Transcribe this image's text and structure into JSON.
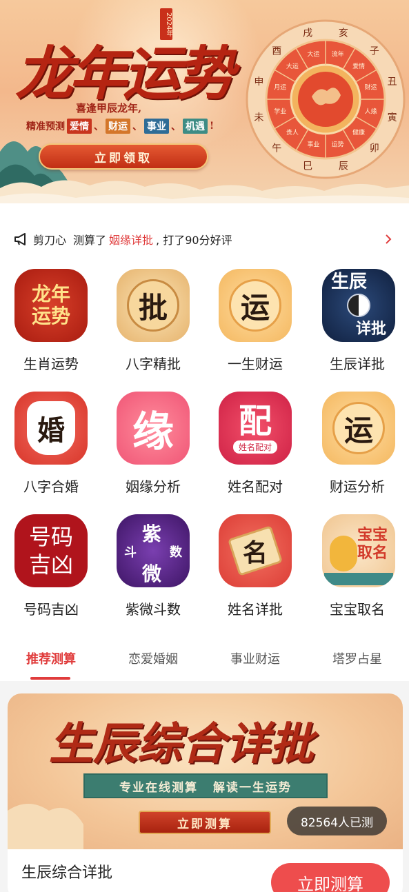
{
  "hero": {
    "title": "龙年运势",
    "year": "2024年",
    "subtitle": "喜逢甲辰龙年,",
    "tags_prefix": "精准预测",
    "tags": [
      "爱情",
      "财运",
      "事业",
      "机遇"
    ],
    "tags_suffix": "!",
    "cta": "立即领取",
    "wheel_outer": [
      "亥",
      "子",
      "丑",
      "寅",
      "卯",
      "辰",
      "巳",
      "午",
      "未",
      "申",
      "酉",
      "戌"
    ],
    "wheel_inner": [
      "流年",
      "爱情",
      "财运",
      "人缘",
      "健康",
      "运势",
      "事业",
      "贵人",
      "学业",
      "月运",
      "大运",
      "大运"
    ]
  },
  "ticker": {
    "user": "剪刀心",
    "action": "测算了",
    "item": "姻缘详批",
    "result": ", 打了90分好评"
  },
  "grid": [
    {
      "label": "生肖运势",
      "icon": "longnian-yunshi-icon",
      "glyph": "龙年运势"
    },
    {
      "label": "八字精批",
      "icon": "pi-icon",
      "glyph": "批"
    },
    {
      "label": "一生财运",
      "icon": "yun-coin-icon",
      "glyph": "运"
    },
    {
      "label": "生辰详批",
      "icon": "shengchen-xiangpi-icon",
      "glyph": "生辰详批"
    },
    {
      "label": "八字合婚",
      "icon": "hun-dress-icon",
      "glyph": "婚"
    },
    {
      "label": "姻缘分析",
      "icon": "yuan-icon",
      "glyph": "缘"
    },
    {
      "label": "姓名配对",
      "icon": "pei-icon",
      "glyph": "配",
      "caption": "姓名配对"
    },
    {
      "label": "财运分析",
      "icon": "yun-coin-icon-2",
      "glyph": "运"
    },
    {
      "label": "号码吉凶",
      "icon": "haoma-jixiong-icon",
      "glyph": "号码吉凶"
    },
    {
      "label": "紫微斗数",
      "icon": "ziwei-doushu-icon",
      "glyph": "紫微斗数"
    },
    {
      "label": "姓名详批",
      "icon": "ming-scroll-icon",
      "glyph": "名"
    },
    {
      "label": "宝宝取名",
      "icon": "baobao-quming-icon",
      "glyph": "宝宝取名"
    }
  ],
  "tabs": [
    "推荐测算",
    "恋爱婚姻",
    "事业财运",
    "塔罗占星"
  ],
  "feature": {
    "banner_title": "生辰综合详批",
    "slogan_left": "专业在线测算",
    "slogan_right": "解读一生运势",
    "banner_button": "立即测算",
    "count": "82564人已测",
    "name": "生辰综合详批",
    "action": "立即测算"
  },
  "colors": {
    "accent": "#e03c3c",
    "hero_red": "#b52412",
    "action_red": "#ee4d4d"
  }
}
